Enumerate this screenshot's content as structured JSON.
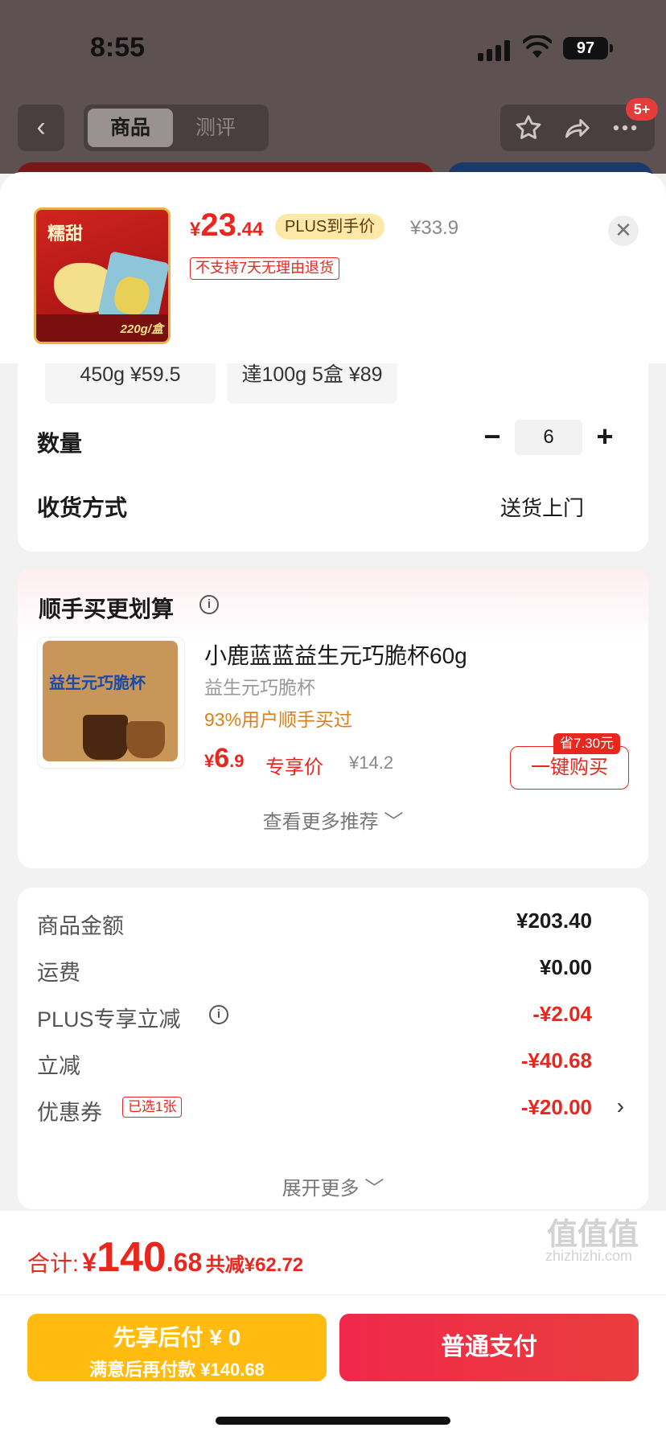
{
  "status": {
    "time": "8:55",
    "battery": "97"
  },
  "nav": {
    "back_icon": "chevron-left-icon",
    "tabs": [
      "商品",
      "测评"
    ],
    "active_tab": "商品",
    "badge": "5+",
    "icons": [
      "star-icon",
      "share-icon",
      "more-icon"
    ]
  },
  "product": {
    "price_yen": "¥",
    "price_int": "23",
    "price_dec": ".44",
    "plus_label": "PLUS到手价",
    "old_price": "¥33.9",
    "return_note": "不支持7天无理由退货",
    "thumb_title": "糯甜",
    "thumb_weight": "220g/盒"
  },
  "options": [
    "450g ¥59.5",
    "達100g 5盒 ¥89"
  ],
  "quantity": {
    "label": "数量",
    "value": "6",
    "minus": "−",
    "plus": "+"
  },
  "delivery": {
    "label": "收货方式",
    "value": "送货上门"
  },
  "recommend": {
    "title": "顺手买更划算",
    "item_name": "小鹿蓝蓝益生元巧脆杯60g",
    "item_sub": "益生元巧脆杯",
    "item_buyers": "93%用户顺手买过",
    "price_yen": "¥",
    "price_int": "6",
    "price_dec": ".9",
    "exclusive": "专享价",
    "old_price": "¥14.2",
    "save_tag": "省7.30元",
    "buy_button": "一键购买",
    "thumb_text": "益生元巧脆杯",
    "more": "查看更多推荐 ﹀"
  },
  "summary": {
    "rows": [
      {
        "label": "商品金额",
        "value": "¥203.40"
      },
      {
        "label": "运费",
        "value": "¥0.00"
      },
      {
        "label": "PLUS专享立减",
        "value": "-¥2.04"
      },
      {
        "label": "立减",
        "value": "-¥40.68"
      },
      {
        "label": "优惠券",
        "value": "-¥20.00"
      }
    ],
    "coupon_tag": "已选1张",
    "expand": "展开更多 ﹀"
  },
  "footer": {
    "total_label": "合计:",
    "total_yen": "¥",
    "total_int": "140",
    "total_dec": ".68",
    "reduced": "共减¥62.72",
    "later_line1": "先享后付 ¥ 0",
    "later_line2": "满意后再付款 ¥140.68",
    "pay_button": "普通支付"
  },
  "watermark": {
    "main": "值值值",
    "sub": "zhizhizhi.com"
  }
}
